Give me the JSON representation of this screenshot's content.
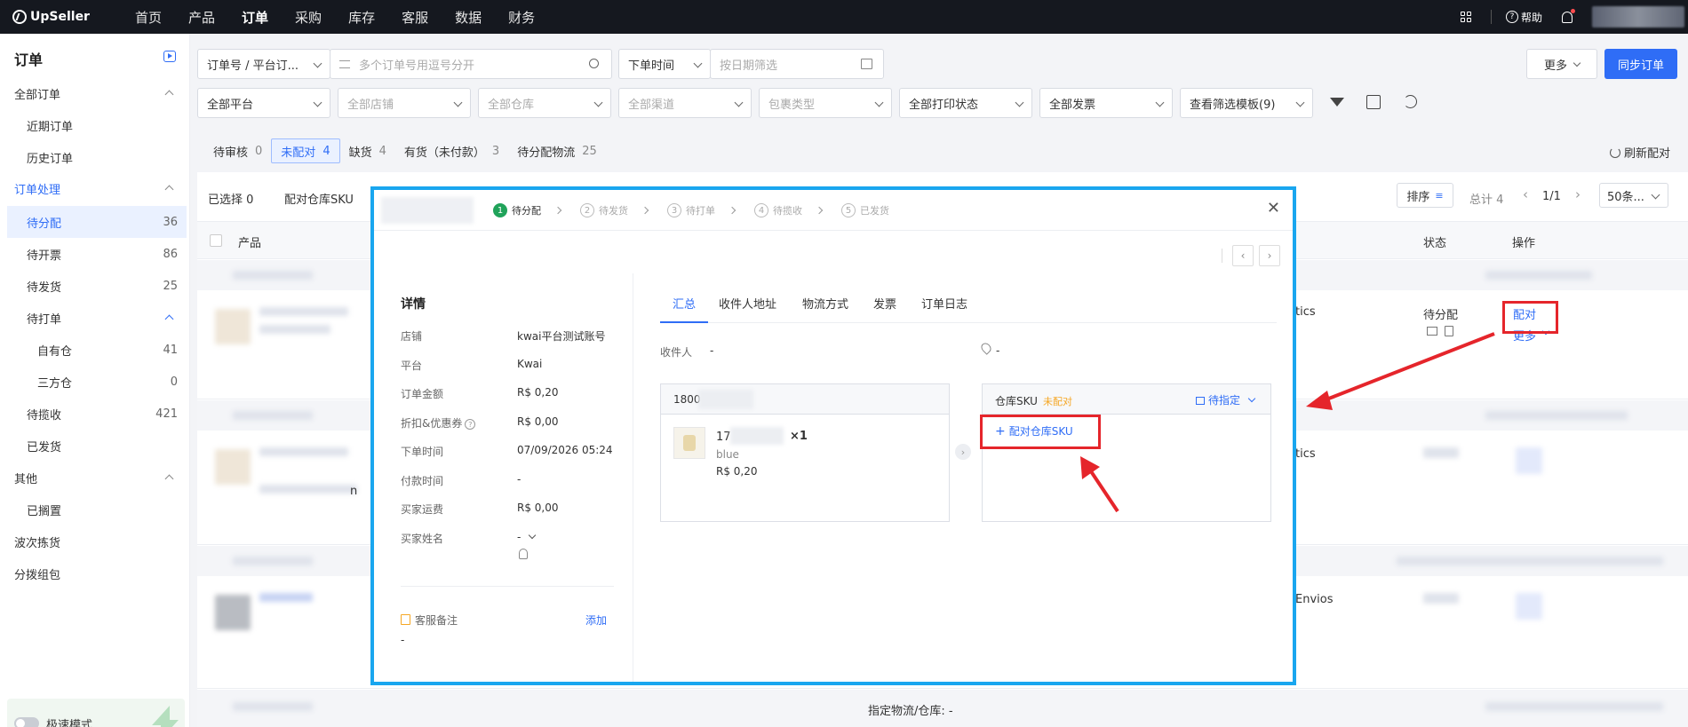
{
  "nav": {
    "logo": "UpSeller",
    "items": [
      "首页",
      "产品",
      "订单",
      "采购",
      "库存",
      "客服",
      "数据",
      "财务"
    ],
    "active_index": 2,
    "help": "帮助"
  },
  "sidebar": {
    "title": "订单",
    "groups": [
      {
        "label": "全部订单",
        "children": [
          {
            "label": "近期订单"
          },
          {
            "label": "历史订单"
          }
        ]
      },
      {
        "label": "订单处理",
        "children": [
          {
            "label": "待分配",
            "count": "36"
          },
          {
            "label": "待开票",
            "count": "86"
          },
          {
            "label": "待发货",
            "count": "25"
          },
          {
            "label": "待打单"
          },
          {
            "label": "自有仓",
            "count": "41"
          },
          {
            "label": "三方仓",
            "count": "0"
          },
          {
            "label": "待揽收",
            "count": "421"
          },
          {
            "label": "已发货"
          }
        ]
      },
      {
        "label": "其他",
        "children": [
          {
            "label": "已搁置"
          }
        ]
      },
      {
        "label": "波次拣货"
      },
      {
        "label": "分拨组包"
      }
    ],
    "speed_mode": "极速模式"
  },
  "filters": {
    "order_type": "订单号 / 平台订...",
    "order_search_placeholder": "多个订单号用逗号分开",
    "time_type": "下单时间",
    "date_placeholder": "按日期筛选",
    "platform": "全部平台",
    "shop": "全部店铺",
    "warehouse": "全部仓库",
    "channel": "全部渠道",
    "package": "包裹类型",
    "print_status": "全部打印状态",
    "invoice": "全部发票",
    "template": "查看筛选模板(9)",
    "more": "更多",
    "sync": "同步订单"
  },
  "status_tabs": [
    {
      "label": "待审核",
      "count": "0"
    },
    {
      "label": "未配对",
      "count": "4"
    },
    {
      "label": "缺货",
      "count": "4"
    },
    {
      "label": "有货（未付款）",
      "count": "3"
    },
    {
      "label": "待分配物流",
      "count": "25"
    }
  ],
  "refresh_match": "刷新配对",
  "table": {
    "selected": "已选择 0",
    "match_sku": "配对仓库SKU",
    "sort": "排序",
    "total": "总计 4",
    "page": "1/1",
    "page_size": "50条...",
    "col_product": "产品",
    "col_status": "状态",
    "col_action": "操作",
    "row1_logistics": "tics",
    "row1_status": "待分配",
    "row1_action": "配对",
    "row1_more": "更多",
    "row2_logistics": "tics",
    "row3_logistics": "Envios",
    "row2_text": "n",
    "footer_text": "指定物流/仓库: -"
  },
  "modal": {
    "steps": [
      {
        "n": "1",
        "label": "待分配"
      },
      {
        "n": "2",
        "label": "待发货"
      },
      {
        "n": "3",
        "label": "待打单"
      },
      {
        "n": "4",
        "label": "待揽收"
      },
      {
        "n": "5",
        "label": "已发货"
      }
    ],
    "details_title": "详情",
    "details": [
      {
        "k": "店铺",
        "v": "kwai平台测试账号"
      },
      {
        "k": "平台",
        "v": "Kwai"
      },
      {
        "k": "订单金额",
        "v": "R$ 0,20"
      },
      {
        "k": "折扣&优惠券",
        "v": "R$ 0,00"
      },
      {
        "k": "下单时间",
        "v": "07/09/2026 05:24"
      },
      {
        "k": "付款时间",
        "v": "-"
      },
      {
        "k": "买家运费",
        "v": "R$ 0,00"
      },
      {
        "k": "买家姓名",
        "v": "-"
      }
    ],
    "remark_label": "客服备注",
    "remark_add": "添加",
    "remark_value": "-",
    "tabs": [
      "汇总",
      "收件人地址",
      "物流方式",
      "发票",
      "订单日志"
    ],
    "recipient_label": "收件人",
    "recipient_value": "-",
    "location_value": "-",
    "order_item": {
      "id_prefix": "1800",
      "sku_prefix": "17",
      "qty": "×1",
      "variant": "blue",
      "price": "R$ 0,20"
    },
    "warehouse_card": {
      "title": "仓库SKU",
      "tag": "未配对",
      "assign": "待指定",
      "add_button": "配对仓库SKU"
    }
  },
  "colors": {
    "accent": "#2f6df6",
    "highlight": "#e5252b",
    "modal_border": "#19a6ef"
  }
}
